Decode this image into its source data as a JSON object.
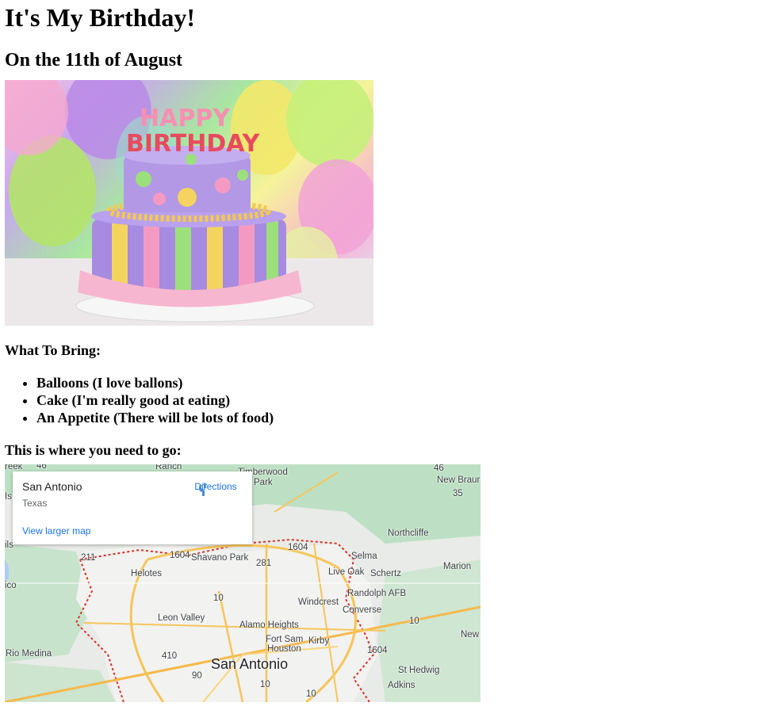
{
  "page": {
    "title": "It's My Birthday!",
    "date": "On the 11th of August",
    "cake_alt": "HAPPY BIRTHDAY",
    "bring_title": "What To Bring:",
    "bring_items": [
      "Balloons (I love ballons)",
      "Cake (I'm really good at eating)",
      "An Appetite (There will be lots of food)"
    ],
    "go_title": "This is where you need to go:"
  },
  "map": {
    "place_name": "San Antonio",
    "place_region": "Texas",
    "directions_label": "Directions",
    "larger_map_label": "View larger map",
    "labels": {
      "creek": "reek",
      "ranch": "Ranch",
      "timberwood": "Timberwood",
      "park": "Park",
      "new_braunfels": "New Braur",
      "is": "Is",
      "northcliffe": "Northcliffe",
      "ils": "ils",
      "shavano": "Shavano Park",
      "selma": "Selma",
      "marion": "Marion",
      "helotes": "Helotes",
      "live_oak": "Live Oak",
      "schertz": "Schertz",
      "ico": "ico",
      "randolph": "Randolph AFB",
      "windcrest": "Windcrest",
      "converse": "Converse",
      "leon_valley": "Leon Valley",
      "alamo": "Alamo Heights",
      "new": "New",
      "fort_sam": "Fort Sam",
      "houston": "Houston",
      "kirby": "Kirby",
      "rio_medina": "Rio Medina",
      "san_antonio": "San Antonio",
      "st_hedwig": "St Hedwig",
      "adkins": "Adkins"
    },
    "shields": [
      "46",
      "46",
      "35",
      "211",
      "1604",
      "1604",
      "281",
      "10",
      "10",
      "410",
      "1604",
      "90",
      "10",
      "10"
    ]
  }
}
